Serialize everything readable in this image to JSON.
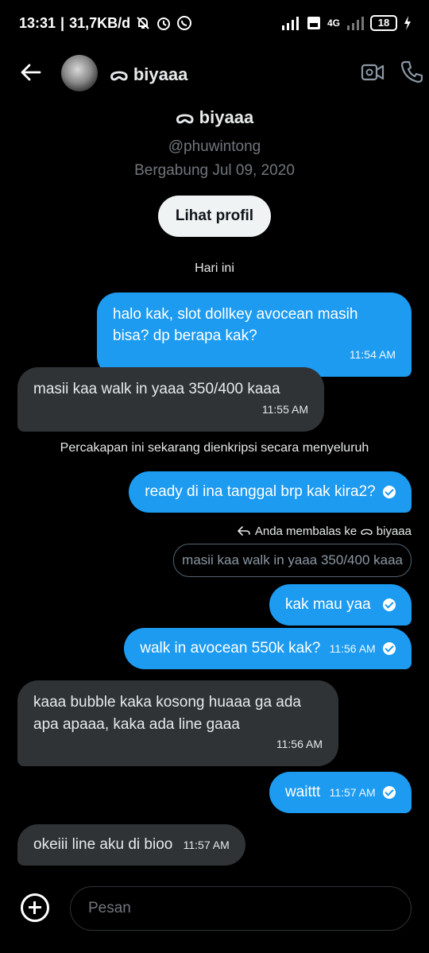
{
  "status_bar": {
    "time": "13:31",
    "speed": "31,7KB/d",
    "network": "4G",
    "battery": "18"
  },
  "header": {
    "name": "ᯅ biyaaa"
  },
  "profile": {
    "name": "ᯅ biyaaa",
    "handle": "@phuwintong",
    "joined": "Bergabung Jul 09, 2020",
    "button_label": "Lihat profil"
  },
  "conversation": {
    "day_label": "Hari ini",
    "encryption_notice": "Percakapan ini sekarang dienkripsi secara menyeluruh",
    "reply_note": "Anda membalas ke ᯅ biyaaa",
    "quoted_text": "masii kaa walk in yaaa 350/400 kaaa",
    "messages": [
      {
        "from": "me",
        "text": "halo kak, slot dollkey avocean masih bisa? dp berapa kak?",
        "time": "11:54 AM"
      },
      {
        "from": "them",
        "text": "masii kaa walk in yaaa 350/400 kaaa",
        "time": "11:55 AM"
      },
      {
        "from": "me",
        "text": "ready di ina tanggal brp kak kira2?",
        "time": ""
      },
      {
        "from": "me",
        "text": "kak mau yaa",
        "time": ""
      },
      {
        "from": "me",
        "text": "walk in avocean 550k kak?",
        "time": "11:56 AM"
      },
      {
        "from": "them",
        "text": "kaaa bubble kaka kosong huaaa ga ada apa apaaa, kaka ada line gaaa",
        "time": "11:56 AM"
      },
      {
        "from": "me",
        "text": "waittt",
        "time": "11:57 AM"
      },
      {
        "from": "them",
        "text": "okeiii line aku di bioo",
        "time": "11:57 AM"
      }
    ]
  },
  "composer": {
    "placeholder": "Pesan"
  },
  "colors": {
    "accent": "#1d9bf0",
    "incoming_bubble": "#2f3336",
    "background": "#000000"
  }
}
